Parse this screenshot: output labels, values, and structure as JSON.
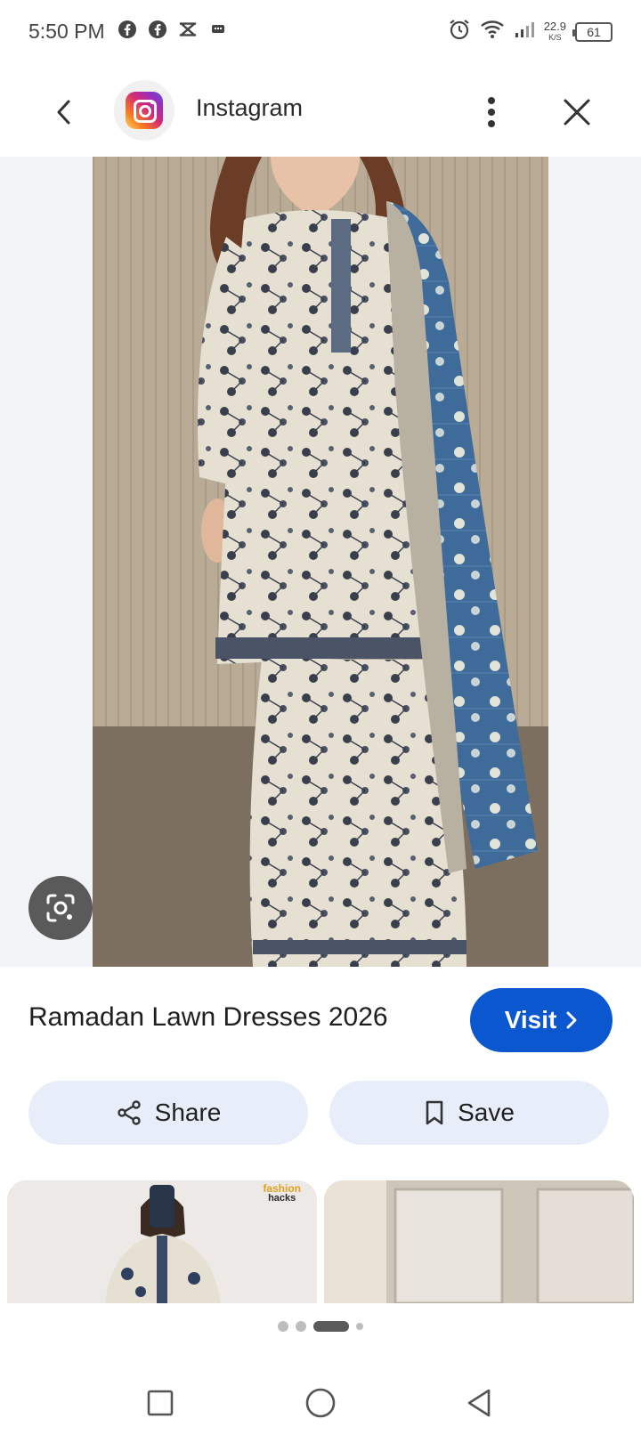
{
  "status_bar": {
    "time": "5:50 PM",
    "left_icons": [
      "facebook-icon",
      "facebook-icon",
      "capcut-icon",
      "message-icon"
    ],
    "right_icons": [
      "alarm-icon",
      "wifi-icon",
      "signal-icon"
    ],
    "net_speed_value": "22.9",
    "net_speed_unit": "K/S",
    "battery": "61"
  },
  "header": {
    "app_name": "Instagram",
    "back_icon": "chevron-left-icon",
    "more_icon": "more-vert-icon",
    "close_icon": "close-icon"
  },
  "result": {
    "title": "Ramadan Lawn Dresses 2026",
    "visit_label": "Visit"
  },
  "actions": {
    "share_label": "Share",
    "save_label": "Save"
  },
  "related": {
    "badge_line1": "fashion",
    "badge_line2": "hacks"
  },
  "colors": {
    "accent": "#0b57d0",
    "action_bg": "#e8eef9",
    "stage_bg": "#f1f3f6"
  }
}
